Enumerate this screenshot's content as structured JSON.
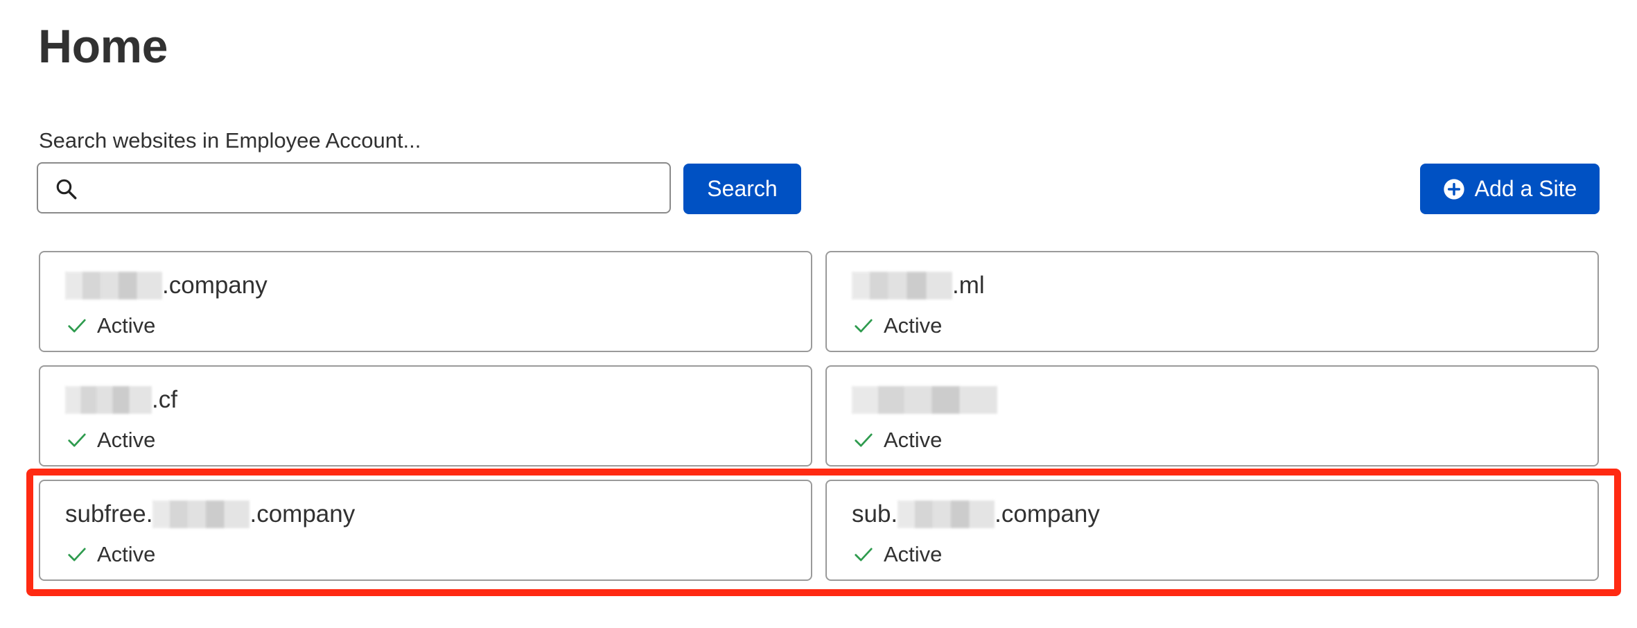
{
  "page": {
    "title": "Home"
  },
  "search": {
    "label": "Search websites in Employee Account...",
    "value": "",
    "placeholder": "",
    "button_label": "Search"
  },
  "toolbar": {
    "add_site_label": "Add a Site"
  },
  "icons": {
    "search": "search-icon",
    "add": "plus-circle-icon",
    "status": "check-icon"
  },
  "colors": {
    "primary": "#0051c3",
    "status_ok": "#2e9b4e",
    "highlight": "#ff2a12"
  },
  "sites": [
    {
      "prefix": "",
      "suffix": ".company",
      "status": "Active"
    },
    {
      "prefix": "",
      "suffix": ".ml",
      "status": "Active"
    },
    {
      "prefix": "",
      "suffix": ".cf",
      "status": "Active"
    },
    {
      "prefix": "",
      "suffix": "",
      "status": "Active"
    },
    {
      "prefix": "subfree.",
      "suffix": ".company",
      "status": "Active"
    },
    {
      "prefix": "sub.",
      "suffix": ".company",
      "status": "Active"
    }
  ]
}
